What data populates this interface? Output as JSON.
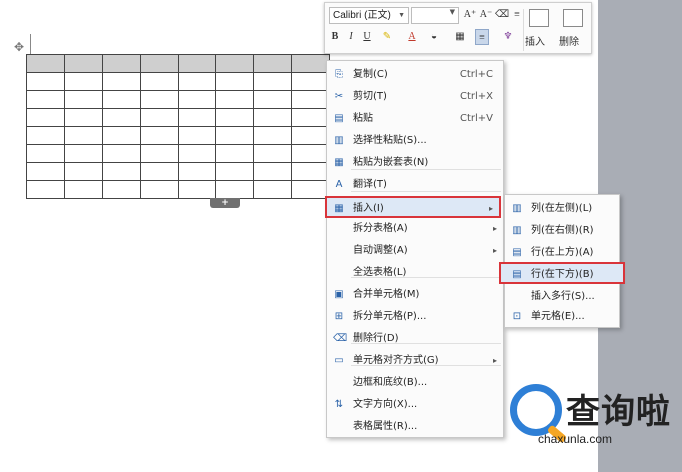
{
  "toolbar": {
    "font_name": "Calibri (正文)",
    "font_size": "",
    "grow_icon": "A⁺",
    "shrink_icon": "A⁻",
    "bold_icon": "B",
    "italic_icon": "I",
    "underline_icon": "U",
    "insert_label": "插入",
    "delete_label": "删除"
  },
  "table": {
    "rows": 8,
    "cols": 8,
    "add_row_icon": "+"
  },
  "context_menu": {
    "items": [
      {
        "icon": "copy-icon",
        "glyph": "⎘",
        "label": "复制(C)",
        "shortcut": "Ctrl+C"
      },
      {
        "icon": "cut-icon",
        "glyph": "✂",
        "label": "剪切(T)",
        "shortcut": "Ctrl+X"
      },
      {
        "icon": "paste-icon",
        "glyph": "▤",
        "label": "粘贴",
        "shortcut": "Ctrl+V"
      },
      {
        "icon": "paste-special-icon",
        "glyph": "▥",
        "label": "选择性粘贴(S)...",
        "shortcut": ""
      },
      {
        "icon": "paste-nested-table-icon",
        "glyph": "▦",
        "label": "粘贴为嵌套表(N)",
        "shortcut": ""
      },
      {
        "icon": "translate-icon",
        "glyph": "A",
        "label": "翻译(T)",
        "shortcut": ""
      },
      {
        "icon": "insert-icon",
        "glyph": "▦",
        "label": "插入(I)",
        "shortcut": ""
      },
      {
        "icon": "",
        "glyph": "",
        "label": "拆分表格(A)",
        "shortcut": ""
      },
      {
        "icon": "",
        "glyph": "",
        "label": "自动调整(A)",
        "shortcut": ""
      },
      {
        "icon": "",
        "glyph": "",
        "label": "全选表格(L)",
        "shortcut": ""
      },
      {
        "icon": "merge-cells-icon",
        "glyph": "▣",
        "label": "合并单元格(M)",
        "shortcut": ""
      },
      {
        "icon": "split-cells-icon",
        "glyph": "⊞",
        "label": "拆分单元格(P)...",
        "shortcut": ""
      },
      {
        "icon": "delete-row-icon",
        "glyph": "⌫",
        "label": "删除行(D)",
        "shortcut": ""
      },
      {
        "icon": "cell-align-icon",
        "glyph": "▭",
        "label": "单元格对齐方式(G)",
        "shortcut": ""
      },
      {
        "icon": "",
        "glyph": "",
        "label": "边框和底纹(B)...",
        "shortcut": ""
      },
      {
        "icon": "text-direction-icon",
        "glyph": "⇅",
        "label": "文字方向(X)...",
        "shortcut": ""
      },
      {
        "icon": "",
        "glyph": "",
        "label": "表格属性(R)...",
        "shortcut": ""
      }
    ],
    "submenu_arrow": "▸"
  },
  "insert_submenu": {
    "items": [
      {
        "icon": "insert-col-left-icon",
        "glyph": "▥",
        "label": "列(在左侧)(L)"
      },
      {
        "icon": "insert-col-right-icon",
        "glyph": "▥",
        "label": "列(在右侧)(R)"
      },
      {
        "icon": "insert-row-above-icon",
        "glyph": "▤",
        "label": "行(在上方)(A)"
      },
      {
        "icon": "insert-row-below-icon",
        "glyph": "▤",
        "label": "行(在下方)(B)"
      },
      {
        "icon": "",
        "glyph": "",
        "label": "插入多行(S)..."
      },
      {
        "icon": "insert-cell-icon",
        "glyph": "⊡",
        "label": "单元格(E)..."
      }
    ]
  },
  "watermark": {
    "title": "查询啦",
    "subtitle": "chaxunla.com"
  }
}
